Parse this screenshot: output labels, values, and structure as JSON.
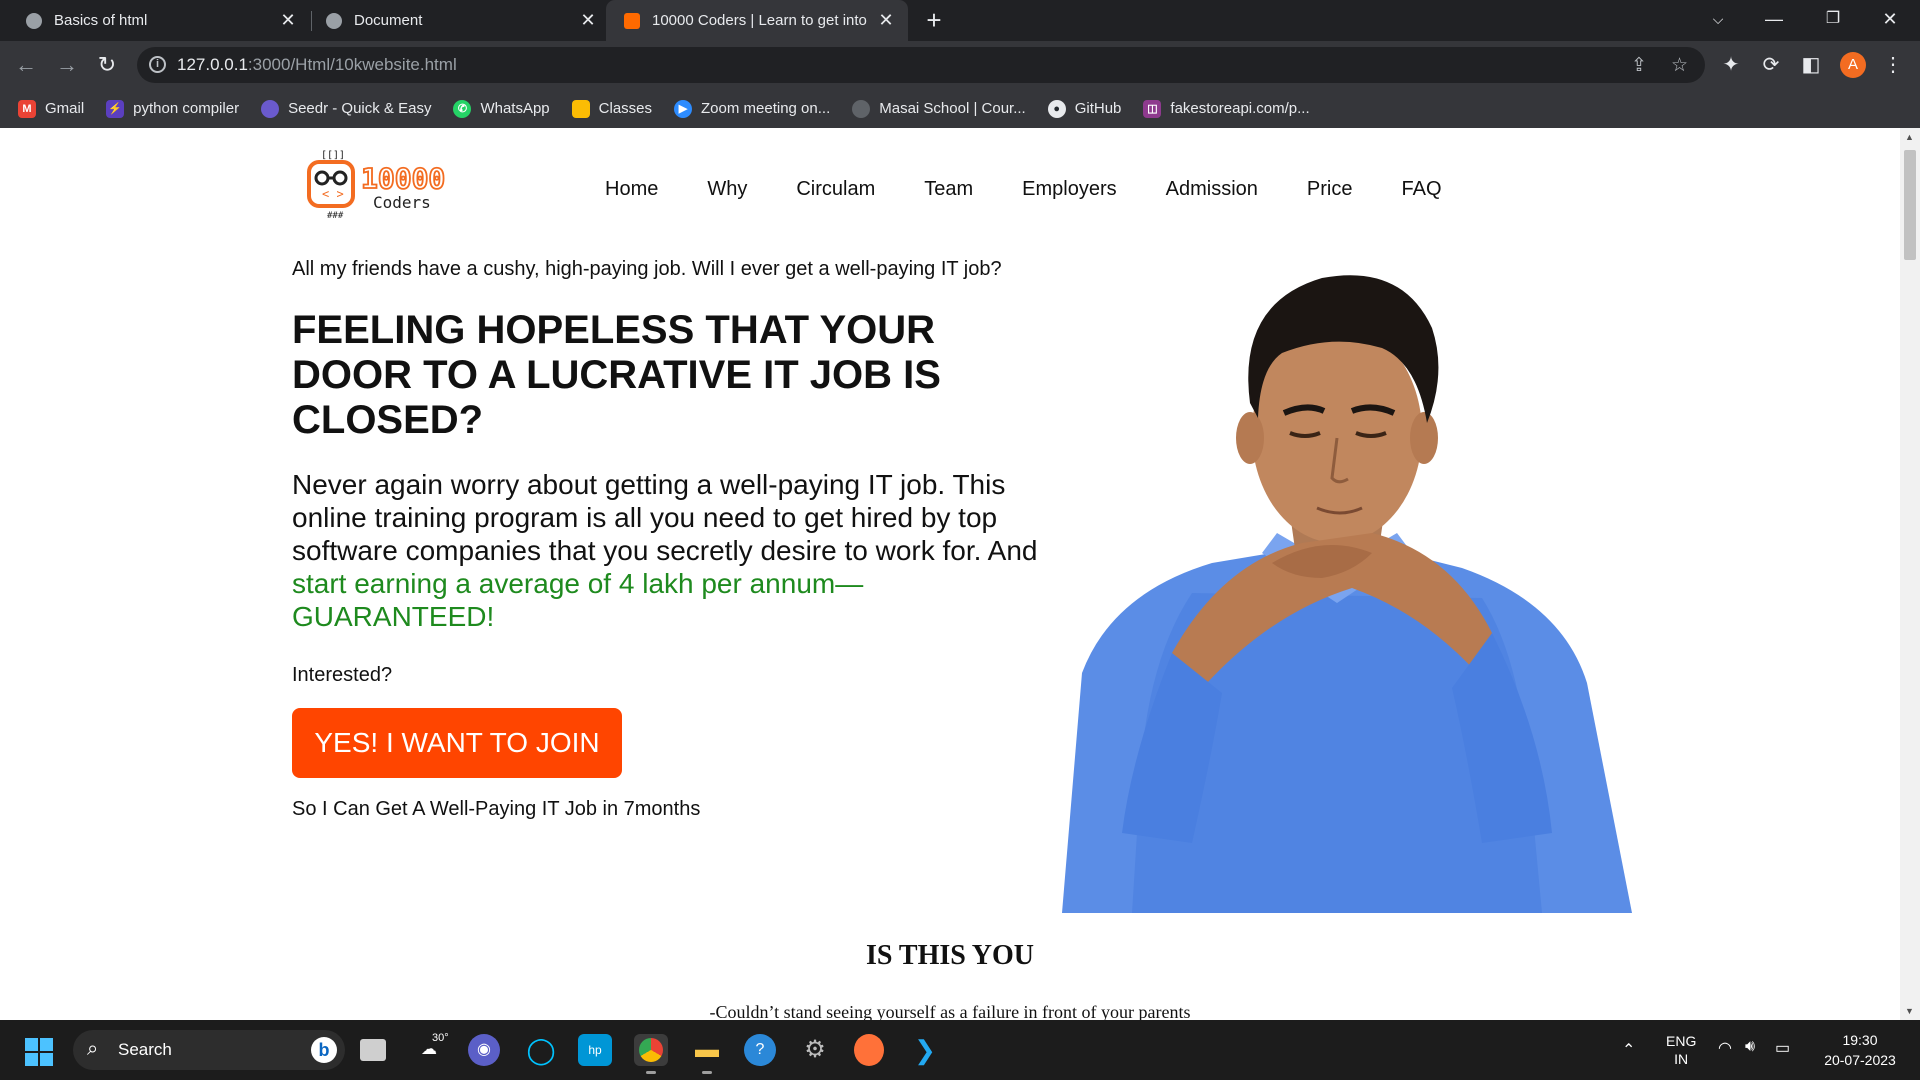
{
  "browser": {
    "tabs": [
      {
        "title": "Basics of html",
        "active": false
      },
      {
        "title": "Document",
        "active": false
      },
      {
        "title": "10000 Coders | Learn to get into",
        "active": true
      }
    ],
    "url_host": "127.0.0.1",
    "url_path": ":3000/Html/10kwebsite.html",
    "profile_initial": "A",
    "bookmarks": [
      {
        "label": "Gmail",
        "icon": "gmail-icon",
        "color": "#ea4335"
      },
      {
        "label": "python compiler",
        "icon": "lightning-icon",
        "color": "#5b3fbf"
      },
      {
        "label": "Seedr - Quick & Easy",
        "icon": "seedr-icon",
        "color": "#6a5acd"
      },
      {
        "label": "WhatsApp",
        "icon": "whatsapp-icon",
        "color": "#25d366"
      },
      {
        "label": "Classes",
        "icon": "classroom-icon",
        "color": "#fbbc04"
      },
      {
        "label": "Zoom meeting on...",
        "icon": "zoom-icon",
        "color": "#2d8cff"
      },
      {
        "label": "Masai School | Cour...",
        "icon": "globe-icon",
        "color": "#5f6368"
      },
      {
        "label": "GitHub",
        "icon": "github-icon",
        "color": "#24292e"
      },
      {
        "label": "fakestoreapi.com/p...",
        "icon": "fakestore-icon",
        "color": "#8e3a8e"
      }
    ]
  },
  "page": {
    "logo_text_top": "10000",
    "logo_text_bottom": "Coders",
    "nav": [
      "Home",
      "Why",
      "Circulam",
      "Team",
      "Employers",
      "Admission",
      "Price",
      "FAQ"
    ],
    "lead_question": "All my friends have a cushy, high-paying job. Will I ever get a well-paying IT job?",
    "headline": "FEELING HOPELESS THAT YOUR DOOR TO A LUCRATIVE IT JOB IS CLOSED?",
    "body_plain": "Never again worry about getting a well-paying IT job. This online training program is all you need to get hired by top software companies that you secretly desire to work for. And ",
    "body_green": "start earning a average of 4 lakh per annum—GUARANTEED!",
    "interested": "Interested?",
    "join_button": "YES! I WANT TO JOIN",
    "sub_cta": "So I Can Get A Well-Paying IT Job in 7months",
    "section_title": "IS THIS YOU",
    "section_line": "-Couldn’t stand seeing yourself as a failure in front of your parents",
    "accent_color": "#ff4500",
    "green_color": "#1e8a1e"
  },
  "taskbar": {
    "search_label": "Search",
    "weather_temp": "30°",
    "language": "ENG",
    "region": "IN",
    "time": "19:30",
    "date": "20-07-2023"
  }
}
